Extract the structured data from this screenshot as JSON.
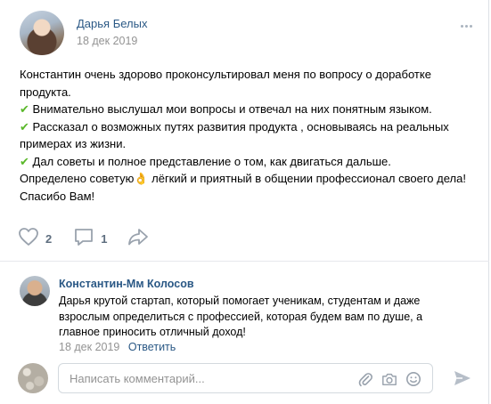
{
  "post": {
    "author": "Дарья Белых",
    "date": "18 дек 2019",
    "lines": [
      {
        "text": "Константин очень здорово проконсультировал меня по вопросу о доработке",
        "icon": ""
      },
      {
        "text": "продукта.",
        "icon": ""
      },
      {
        "text": "Внимательно выслушал мои вопросы и отвечал на них понятным языком.",
        "icon": "✔"
      },
      {
        "text": "Рассказал о возможных путях развития продукта , основываясь на реальных",
        "icon": "✔"
      },
      {
        "text": "примерах из жизни.",
        "icon": ""
      },
      {
        "text": "Дал советы и полное представление о том, как двигаться дальше.",
        "icon": "✔"
      },
      {
        "text": "Определено советую👌 лёгкий и приятный в общении профессионал своего дела!",
        "icon": ""
      },
      {
        "text": "Спасибо Вам!",
        "icon": ""
      }
    ],
    "likes": "2",
    "comments": "1"
  },
  "comment": {
    "author": "Константин-Мм Колосов",
    "lines": [
      "Дарья крутой стартап, который помогает ученикам, студентам и даже",
      "взрослым определиться с профессией, которая будем вам по душе, а",
      "главное приносить отличный доход!"
    ],
    "date": "18 дек 2019",
    "reply_label": "Ответить"
  },
  "composer": {
    "placeholder": "Написать комментарий..."
  },
  "colors": {
    "link": "#2a5885",
    "muted": "#939393",
    "icon": "#99a2ad",
    "check": "#5ab82a"
  },
  "icons": [
    "more-icon",
    "heart-icon",
    "comment-icon",
    "share-icon",
    "paperclip-icon",
    "camera-icon",
    "emoji-icon",
    "send-icon"
  ]
}
